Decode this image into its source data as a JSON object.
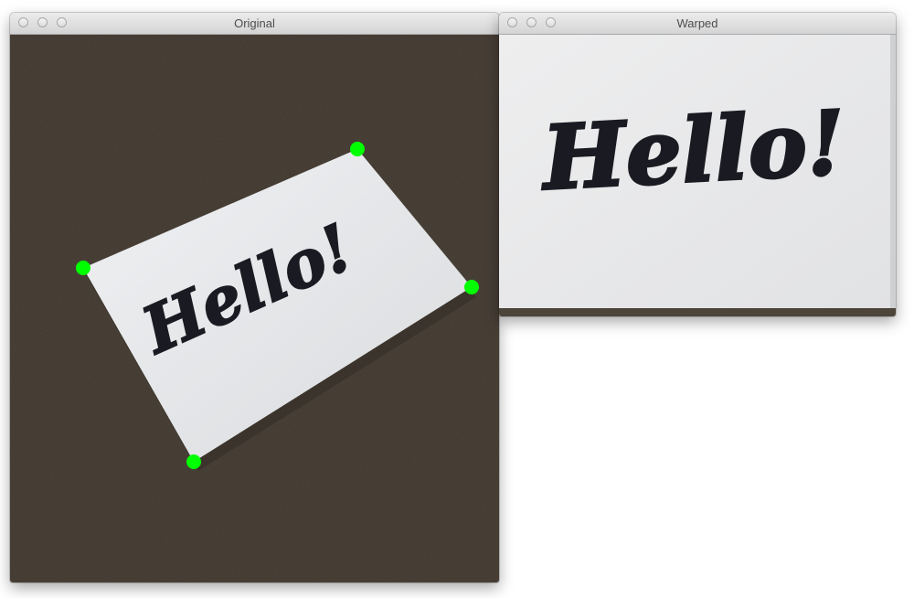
{
  "windows": {
    "original": {
      "title": "Original",
      "image": {
        "note_text": "Hello!",
        "background_color": "#4d443a",
        "paper_color": "#e6e7e9",
        "ink_color": "#1a1a22",
        "marker_color": "#00ff00"
      }
    },
    "warped": {
      "title": "Warped",
      "image": {
        "note_text": "Hello!",
        "paper_color": "#e9e9ea",
        "ink_color": "#1a1a22"
      }
    }
  },
  "icons": {
    "close": "close-traffic-light-icon",
    "minimize": "minimize-traffic-light-icon",
    "zoom": "zoom-traffic-light-icon"
  }
}
